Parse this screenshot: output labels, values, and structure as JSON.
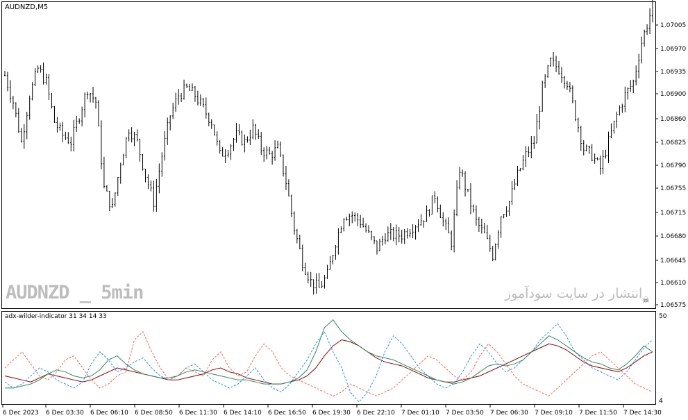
{
  "symbol_label": "AUDNZD,M5",
  "indicator_label": "adx-wilder-indicator 31 34 14 33",
  "watermark_left": "AUDNZD _ 5min",
  "watermark_right": "انتشار در سایت سودآموز",
  "colors": {
    "candle": "#000000",
    "adx": "#8b0000",
    "plus_di": "#1e90ff",
    "minus_di": "#ff6347",
    "adxr": "#2e8b57"
  },
  "chart_data": [
    {
      "type": "ohlc",
      "title": "AUDNZD,M5",
      "y_ticks": [
        "1.07005",
        "1.06970",
        "1.06935",
        "1.06900",
        "1.06860",
        "1.06825",
        "1.06790",
        "1.06755",
        "1.06715",
        "1.06680",
        "1.06645",
        "1.06610",
        "1.06575"
      ],
      "ylim": [
        1.0657,
        1.0703
      ],
      "x_ticks": [
        "6 Dec 2023",
        "6 Dec 03:30",
        "6 Dec 06:10",
        "6 Dec 08:50",
        "6 Dec 11:30",
        "6 Dec 14:10",
        "6 Dec 16:50",
        "6 Dec 19:30",
        "6 Dec 22:10",
        "7 Dec 01:10",
        "7 Dec 03:50",
        "7 Dec 06:30",
        "7 Dec 09:10",
        "7 Dec 11:50",
        "7 Dec 14:30"
      ],
      "close_path": [
        [
          0,
          1.0692
        ],
        [
          3,
          1.0688
        ],
        [
          6,
          1.0682
        ],
        [
          9,
          1.0689
        ],
        [
          12,
          1.0693
        ],
        [
          15,
          1.0691
        ],
        [
          18,
          1.0685
        ],
        [
          21,
          1.0683
        ],
        [
          24,
          1.0682
        ],
        [
          27,
          1.0686
        ],
        [
          30,
          1.069
        ],
        [
          33,
          1.0688
        ],
        [
          36,
          1.0675
        ],
        [
          39,
          1.0672
        ],
        [
          42,
          1.0679
        ],
        [
          45,
          1.0684
        ],
        [
          48,
          1.0682
        ],
        [
          51,
          1.0677
        ],
        [
          54,
          1.0673
        ],
        [
          57,
          1.068
        ],
        [
          60,
          1.0686
        ],
        [
          63,
          1.0689
        ],
        [
          66,
          1.069
        ],
        [
          69,
          1.0689
        ],
        [
          72,
          1.0687
        ],
        [
          75,
          1.0685
        ],
        [
          78,
          1.068
        ],
        [
          81,
          1.0681
        ],
        [
          84,
          1.0683
        ],
        [
          87,
          1.0682
        ],
        [
          90,
          1.0684
        ],
        [
          93,
          1.0681
        ],
        [
          96,
          1.068
        ],
        [
          99,
          1.0681
        ],
        [
          102,
          1.0676
        ],
        [
          105,
          1.0669
        ],
        [
          108,
          1.0664
        ],
        [
          111,
          1.0661
        ],
        [
          114,
          1.066
        ],
        [
          117,
          1.0662
        ],
        [
          120,
          1.0667
        ],
        [
          123,
          1.0671
        ],
        [
          126,
          1.0671
        ],
        [
          129,
          1.067
        ],
        [
          132,
          1.0668
        ],
        [
          135,
          1.0666
        ],
        [
          138,
          1.0668
        ],
        [
          141,
          1.0668
        ],
        [
          144,
          1.0668
        ],
        [
          147,
          1.0669
        ],
        [
          150,
          1.067
        ],
        [
          153,
          1.0671
        ],
        [
          156,
          1.0674
        ],
        [
          159,
          1.067
        ],
        [
          162,
          1.0667
        ],
        [
          165,
          1.0678
        ],
        [
          168,
          1.0674
        ],
        [
          171,
          1.067
        ],
        [
          174,
          1.0668
        ],
        [
          177,
          1.0665
        ],
        [
          180,
          1.0671
        ],
        [
          183,
          1.0673
        ],
        [
          186,
          1.0677
        ],
        [
          189,
          1.068
        ],
        [
          192,
          1.0682
        ],
        [
          195,
          1.069
        ],
        [
          198,
          1.0694
        ],
        [
          201,
          1.0693
        ],
        [
          204,
          1.0691
        ],
        [
          207,
          1.0686
        ],
        [
          210,
          1.0681
        ],
        [
          213,
          1.068
        ],
        [
          216,
          1.0678
        ],
        [
          219,
          1.0682
        ],
        [
          222,
          1.0686
        ],
        [
          225,
          1.0689
        ],
        [
          228,
          1.0691
        ],
        [
          231,
          1.0697
        ],
        [
          234,
          1.0701
        ],
        [
          235,
          1.0703
        ]
      ],
      "close_path_x_units": "candle index"
    },
    {
      "type": "line",
      "title": "adx-wilder-indicator 31 34 14 33",
      "y_ticks": [
        "50",
        "4"
      ],
      "ylim": [
        4,
        50
      ],
      "series": [
        {
          "name": "",
          "color": "#8b0000",
          "values": [
            18,
            17,
            16,
            15,
            17,
            19,
            18,
            17,
            16,
            15,
            16,
            18,
            20,
            22,
            21,
            20,
            19,
            18,
            17,
            16,
            16,
            17,
            18,
            19,
            21,
            22,
            20,
            19,
            17,
            16,
            15,
            14,
            14,
            15,
            16,
            18,
            22,
            28,
            33,
            36,
            35,
            33,
            30,
            27,
            25,
            24,
            23,
            21,
            19,
            17,
            16,
            15,
            15,
            16,
            17,
            18,
            20,
            22,
            24,
            26,
            28,
            30,
            32,
            34,
            33,
            31,
            28,
            25,
            23,
            22,
            21,
            20,
            22,
            25,
            28,
            30
          ]
        },
        {
          "name": "",
          "color": "#1e90ff",
          "values": [
            15,
            12,
            14,
            18,
            22,
            20,
            16,
            14,
            12,
            15,
            24,
            30,
            26,
            20,
            22,
            25,
            27,
            22,
            18,
            16,
            18,
            22,
            24,
            20,
            16,
            14,
            12,
            14,
            18,
            22,
            16,
            12,
            10,
            14,
            20,
            26,
            34,
            40,
            30,
            22,
            10,
            5,
            10,
            18,
            30,
            38,
            34,
            28,
            22,
            18,
            14,
            12,
            14,
            20,
            28,
            34,
            30,
            24,
            20,
            22,
            26,
            30,
            36,
            40,
            44,
            38,
            30,
            26,
            22,
            20,
            18,
            16,
            20,
            26,
            32,
            36
          ]
        },
        {
          "name": "",
          "color": "#ff6347",
          "values": [
            22,
            26,
            30,
            24,
            18,
            16,
            20,
            26,
            28,
            22,
            16,
            12,
            14,
            18,
            20,
            36,
            40,
            30,
            22,
            16,
            18,
            22,
            20,
            18,
            26,
            30,
            22,
            18,
            20,
            28,
            34,
            30,
            22,
            18,
            16,
            14,
            12,
            10,
            8,
            10,
            14,
            12,
            10,
            8,
            10,
            12,
            16,
            20,
            24,
            28,
            26,
            22,
            18,
            16,
            20,
            28,
            34,
            30,
            24,
            18,
            14,
            12,
            10,
            8,
            12,
            16,
            20,
            24,
            28,
            30,
            26,
            22,
            18,
            14,
            12,
            10
          ]
        },
        {
          "name": "",
          "color": "#2e8b57",
          "values": [
            12,
            12,
            13,
            14,
            16,
            19,
            21,
            20,
            18,
            17,
            18,
            21,
            26,
            28,
            24,
            21,
            19,
            18,
            17,
            17,
            18,
            20,
            21,
            20,
            19,
            18,
            17,
            16,
            16,
            15,
            14,
            14,
            14,
            15,
            17,
            21,
            30,
            42,
            46,
            40,
            36,
            33,
            30,
            28,
            27,
            26,
            24,
            22,
            20,
            18,
            16,
            15,
            14,
            15,
            17,
            20,
            23,
            24,
            23,
            24,
            26,
            30,
            34,
            38,
            36,
            33,
            30,
            27,
            25,
            24,
            22,
            21,
            24,
            28,
            33,
            30
          ]
        }
      ]
    }
  ]
}
